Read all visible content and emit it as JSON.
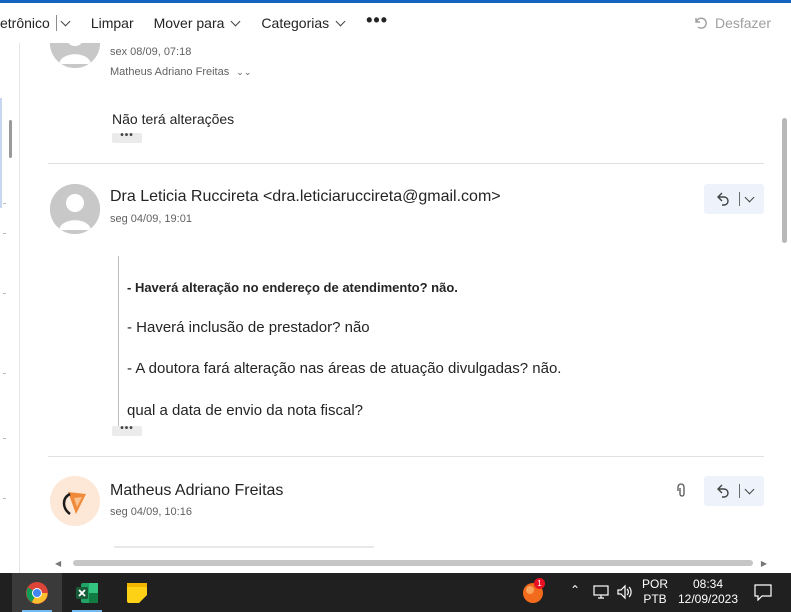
{
  "toolbar": {
    "truncated_left": "etrônico",
    "clear": "Limpar",
    "move_to": "Mover para",
    "categories": "Categorias",
    "more": "•••",
    "undo": "Desfazer"
  },
  "messages": [
    {
      "date": "sex 08/09, 07:18",
      "recipient": "Matheus Adriano Freitas",
      "body": [
        "Não terá alterações"
      ],
      "more_label": "•••"
    },
    {
      "sender": "Dra Leticia Ruccireta <dra.leticiaruccireta@gmail.com>",
      "date": "seg 04/09, 19:01",
      "body": [
        "- Haverá alteração no endereço de atendimento? não.",
        "- Haverá inclusão de prestador? não",
        "- A doutora fará alteração nas áreas de atuação divulgadas? não.",
        "qual a data de envio da nota fiscal?"
      ],
      "more_label": "•••"
    },
    {
      "sender": "Matheus Adriano Freitas",
      "date": "seg 04/09, 10:16"
    }
  ],
  "taskbar": {
    "apps": [
      "chrome-icon",
      "excel-icon",
      "sticky-notes-icon"
    ],
    "notification_badge": "1",
    "language_line1": "POR",
    "language_line2": "PTB",
    "time": "08:34",
    "date": "12/09/2023"
  },
  "colors": {
    "accent": "#1565c0",
    "reply_button_bg": "#eef3fb",
    "taskbar_bg": "#202020"
  }
}
